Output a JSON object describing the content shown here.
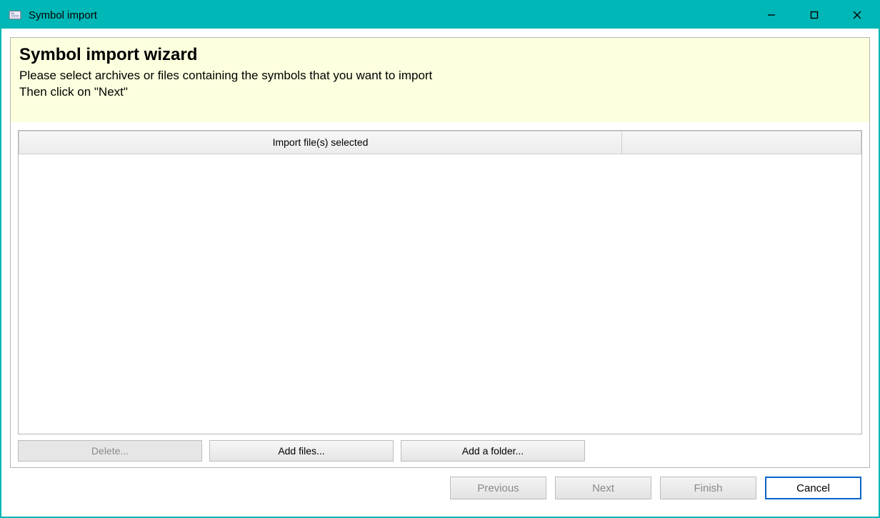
{
  "window": {
    "title": "Symbol import"
  },
  "wizard": {
    "title": "Symbol import wizard",
    "description_line1": "Please select archives or files containing the symbols that you want to import",
    "description_line2": "Then click on \"Next\""
  },
  "table": {
    "column1_header": "Import file(s) selected",
    "column2_header": ""
  },
  "actions": {
    "delete_label": "Delete...",
    "add_files_label": "Add files...",
    "add_folder_label": "Add a folder..."
  },
  "nav": {
    "previous_label": "Previous",
    "next_label": "Next",
    "finish_label": "Finish",
    "cancel_label": "Cancel"
  }
}
